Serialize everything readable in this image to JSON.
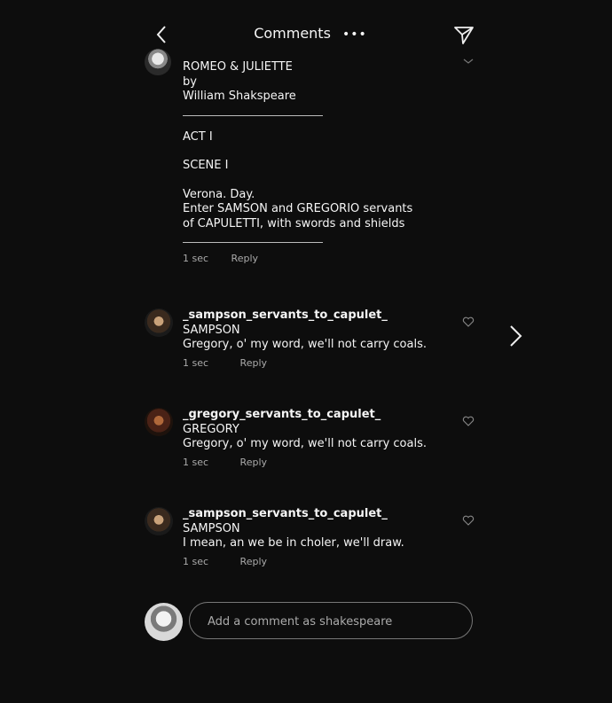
{
  "header": {
    "title": "Comments",
    "more_label": "•••"
  },
  "post": {
    "lines": [
      "ROMEO & JULIETTE",
      "by",
      "William Shakspeare",
      "ACT I",
      "SCENE I",
      "Verona. Day.",
      "Enter SAMSON and GREGORIO servants",
      "of CAPULETTI, with swords and shields"
    ],
    "time": "1 sec",
    "reply_label": "Reply"
  },
  "comments": [
    {
      "username": "_sampson_servants_to_capulet_",
      "speaker": "SAMPSON",
      "text": "Gregory, o' my word, we'll not carry coals.",
      "time": "1 sec",
      "reply_label": "Reply"
    },
    {
      "username": "_gregory_servants_to_capulet_",
      "speaker": "GREGORY",
      "text": "Gregory, o' my word, we'll not carry coals.",
      "time": "1 sec",
      "reply_label": "Reply"
    },
    {
      "username": "_sampson_servants_to_capulet_",
      "speaker": "SAMPSON",
      "text": "I mean, an we be in choler, we'll draw.",
      "time": "1 sec",
      "reply_label": "Reply"
    }
  ],
  "composer": {
    "placeholder": "Add a comment as shakespeare",
    "value": ""
  },
  "icons": {
    "back": "chevron-left-icon",
    "send": "paper-plane-icon",
    "like": "heart-icon",
    "next": "chevron-right-icon"
  },
  "colors": {
    "background": "#0d0d0d",
    "text": "#f5f5f5",
    "muted": "#aaaaaa"
  }
}
